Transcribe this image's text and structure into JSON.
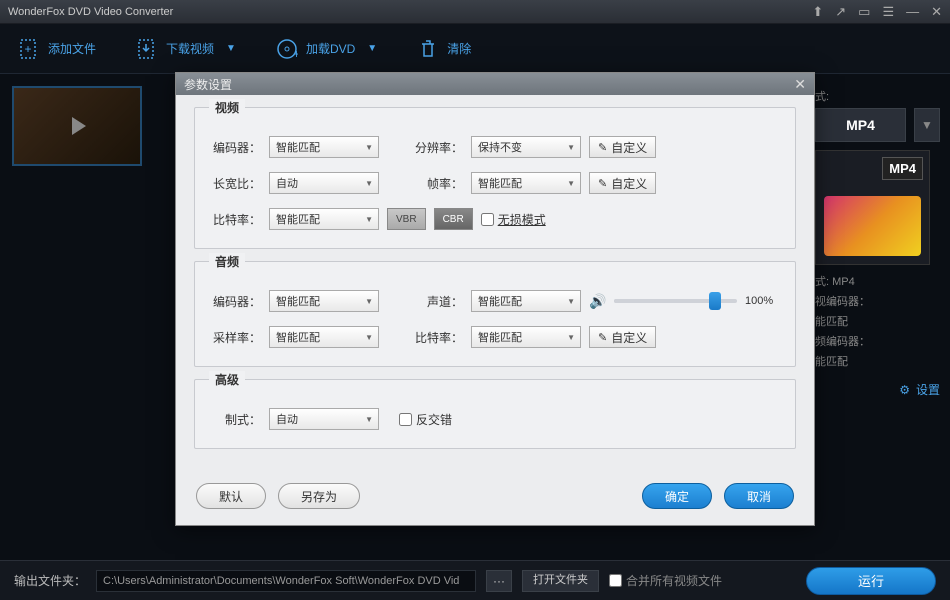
{
  "titlebar": {
    "title": "WonderFox DVD Video Converter"
  },
  "toolbar": {
    "add_file": "添加文件",
    "download_video": "下载视频",
    "load_dvd": "加载DVD",
    "clear": "清除"
  },
  "right": {
    "format_suffix": "式:",
    "format": "MP4",
    "badge": "MP4",
    "meta_format": "式: MP4",
    "meta_vcodec": "视编码器：",
    "meta_smart1": "能匹配",
    "meta_acodec": "频编码器：",
    "meta_smart2": "能匹配",
    "settings": "设置"
  },
  "bottom": {
    "output_label": "输出文件夹：",
    "path": "C:\\Users\\Administrator\\Documents\\WonderFox Soft\\WonderFox DVD Vid",
    "ellipsis": "···",
    "open_folder": "打开文件夹",
    "merge": "合并所有视频文件",
    "run": "运行"
  },
  "dialog": {
    "title": "参数设置",
    "video": {
      "heading": "视频",
      "encoder_label": "编码器：",
      "encoder_value": "智能匹配",
      "resolution_label": "分辨率：",
      "resolution_value": "保持不变",
      "custom": "自定义",
      "aspect_label": "长宽比：",
      "aspect_value": "自动",
      "fps_label": "帧率：",
      "fps_value": "智能匹配",
      "bitrate_label": "比特率：",
      "bitrate_value": "智能匹配",
      "vbr": "VBR",
      "cbr": "CBR",
      "lossless": "无损模式"
    },
    "audio": {
      "heading": "音频",
      "encoder_label": "编码器：",
      "encoder_value": "智能匹配",
      "channel_label": "声道：",
      "channel_value": "智能匹配",
      "volume_pct": "100%",
      "sample_label": "采样率：",
      "sample_value": "智能匹配",
      "bitrate_label": "比特率：",
      "bitrate_value": "智能匹配",
      "custom": "自定义"
    },
    "advanced": {
      "heading": "高级",
      "standard_label": "制式：",
      "standard_value": "自动",
      "deinterlace": "反交错"
    },
    "footer": {
      "default": "默认",
      "save_as": "另存为",
      "ok": "确定",
      "cancel": "取消"
    }
  }
}
